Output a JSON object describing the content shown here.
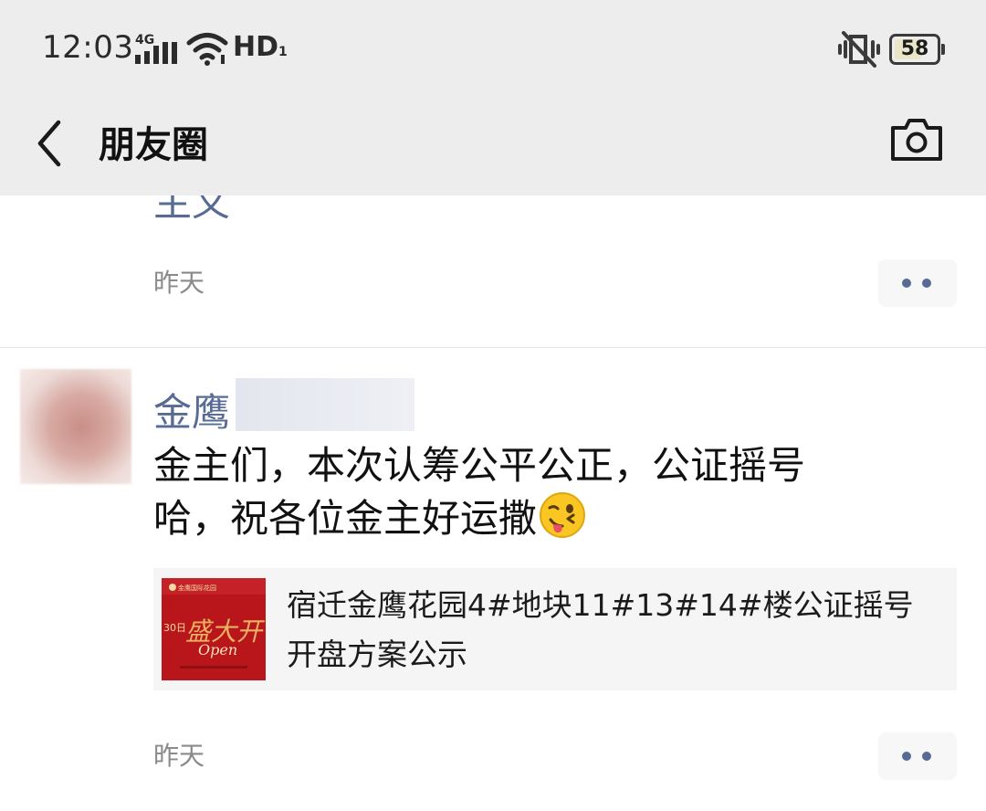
{
  "status_bar": {
    "time": "12:03",
    "network": "4G",
    "hd": "HD",
    "hd_sub": "1",
    "battery": "58"
  },
  "nav": {
    "title": "朋友圈"
  },
  "feed": {
    "prev_post": {
      "name_partial": "主义",
      "time": "昨天"
    },
    "post": {
      "name": "金鹰",
      "text_line1": "金主们，本次认筹公平公正，公证摇号",
      "text_line2": "哈，祝各位金主好运撒",
      "link": {
        "title": "宿迁金鹰花园4#地块11#13#14#楼公证摇号开盘方案公示",
        "thumb_text_top": "金鹰国际花园",
        "thumb_text_big": "盛大开",
        "thumb_text_script": "Open",
        "thumb_text_date": "30日"
      },
      "time": "昨天"
    }
  },
  "colors": {
    "bar_bg": "#ededed",
    "name_link": "#576b95",
    "meta_text": "#8a8a8a",
    "thumb_red": "#b8161b"
  },
  "icons": {
    "back": "chevron-left-icon",
    "camera": "camera-icon",
    "more": "more-dots-icon",
    "emoji": "wink-tongue-emoji-icon"
  }
}
